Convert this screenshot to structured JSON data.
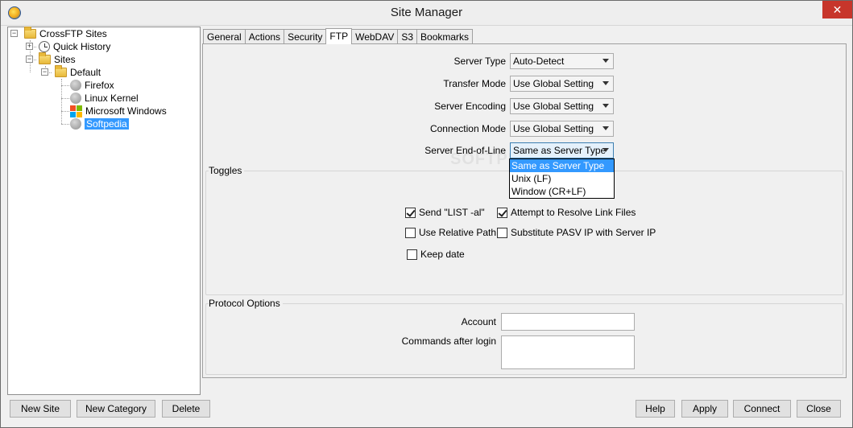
{
  "window": {
    "title": "Site Manager",
    "close_glyph": "✕"
  },
  "tree": {
    "root": "CrossFTP Sites",
    "quick_history": "Quick History",
    "sites": "Sites",
    "default": "Default",
    "items": [
      "Firefox",
      "Linux Kernel",
      "Microsoft Windows",
      "Softpedia"
    ],
    "expanded_glyph": "−",
    "collapsed_glyph": "+"
  },
  "tabs": [
    "General",
    "Actions",
    "Security",
    "FTP",
    "WebDAV",
    "S3",
    "Bookmarks"
  ],
  "active_tab": "FTP",
  "ftp": {
    "fields": [
      {
        "label": "Server Type",
        "value": "Auto-Detect"
      },
      {
        "label": "Transfer Mode",
        "value": "Use Global Setting"
      },
      {
        "label": "Server Encoding",
        "value": "Use Global Setting"
      },
      {
        "label": "Connection Mode",
        "value": "Use Global Setting"
      },
      {
        "label": "Server End-of-Line",
        "value": "Same as Server Type"
      }
    ],
    "eol_options": [
      "Same as Server Type",
      "Unix (LF)",
      "Window (CR+LF)"
    ],
    "eol_highlighted": "Same as Server Type"
  },
  "toggles": {
    "title": "Toggles",
    "send_list_al": {
      "label": "Send \"LIST -al\"",
      "checked": true
    },
    "resolve_link": {
      "label": "Attempt to Resolve Link Files",
      "checked": true
    },
    "relative_path": {
      "label": "Use Relative Path",
      "checked": false
    },
    "substitute_pasv": {
      "label": "Substitute PASV IP with Server IP",
      "checked": false
    },
    "keep_date": {
      "label": "Keep date",
      "checked": false
    }
  },
  "protocol": {
    "title": "Protocol Options",
    "account_label": "Account",
    "account_value": "",
    "commands_label": "Commands after login",
    "commands_value": ""
  },
  "buttons": {
    "new_site": "New Site",
    "new_category": "New Category",
    "delete": "Delete",
    "help": "Help",
    "apply": "Apply",
    "connect": "Connect",
    "close": "Close"
  },
  "watermark": "SOFTPEDIA"
}
